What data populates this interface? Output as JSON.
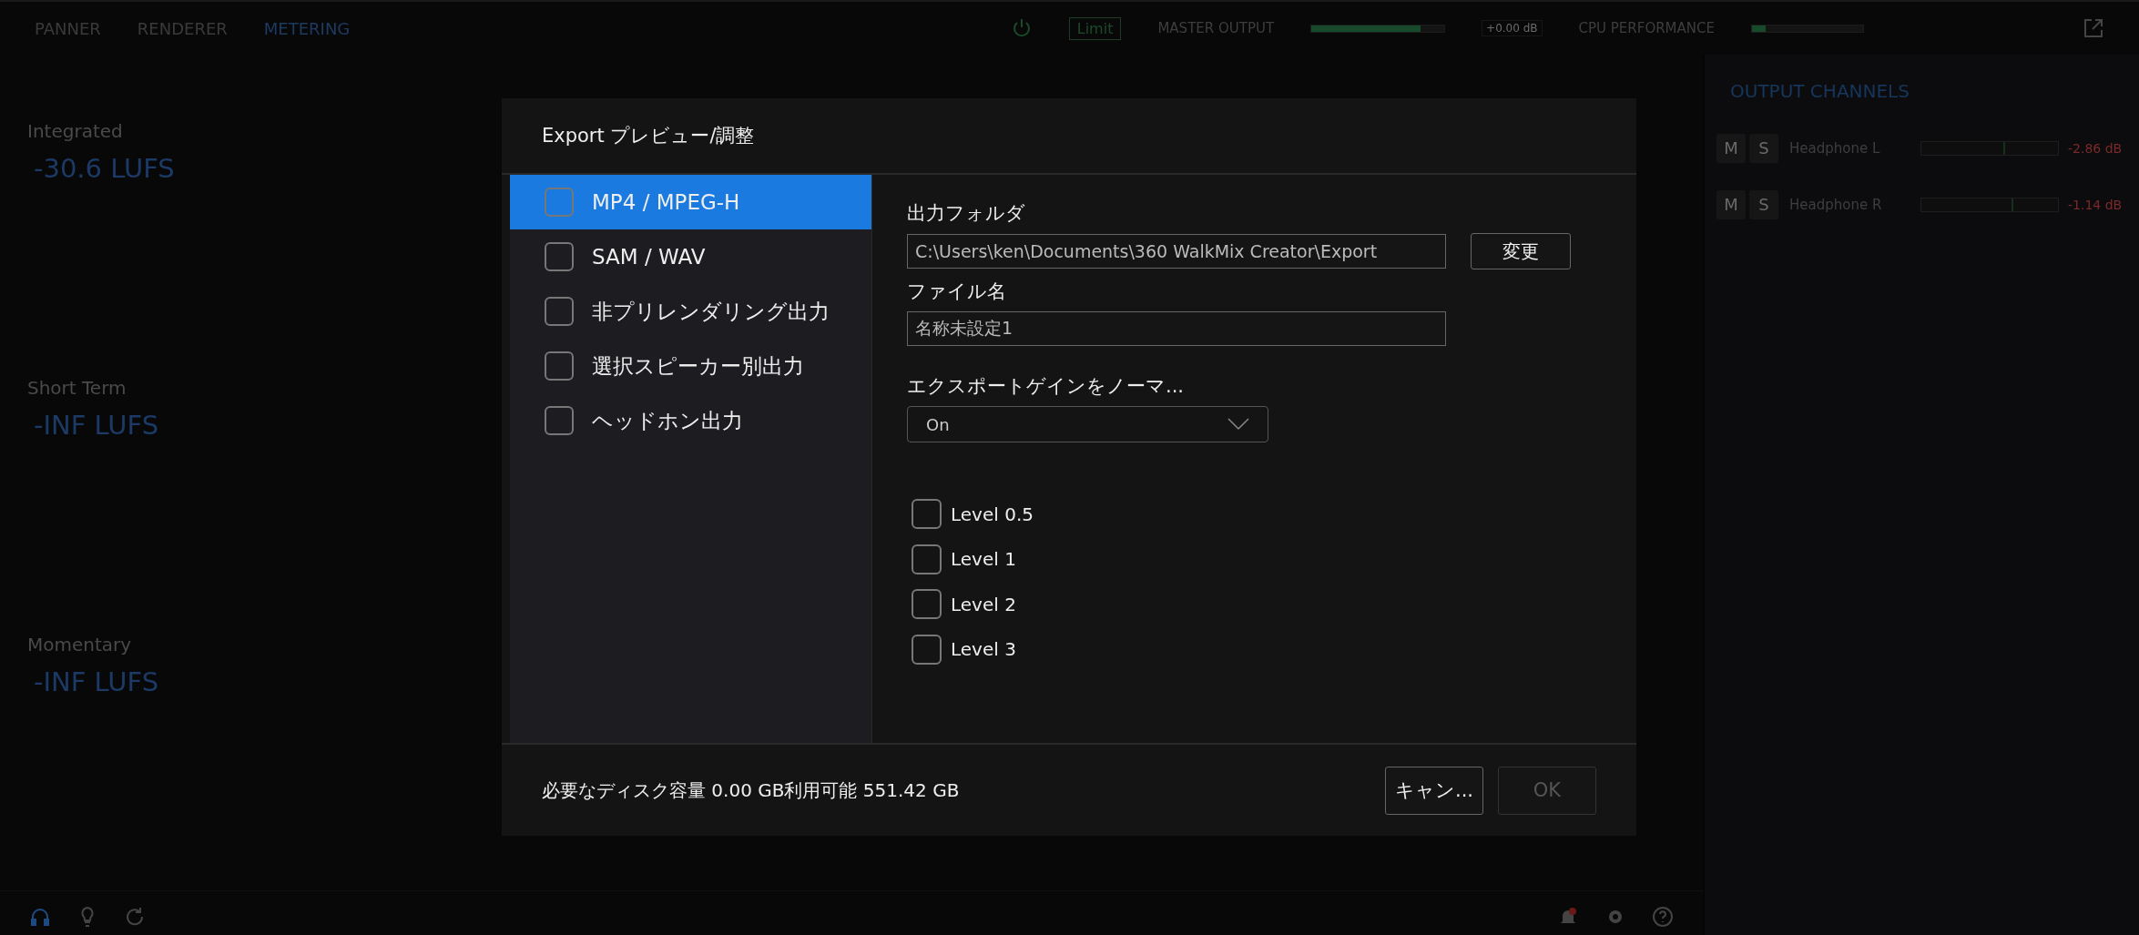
{
  "top_bar": {
    "tabs": [
      {
        "label": "PANNER",
        "selected": false
      },
      {
        "label": "RENDERER",
        "selected": false
      },
      {
        "label": "METERING",
        "selected": true
      }
    ],
    "limit": "Limit",
    "master_output": {
      "label": "MASTER OUTPUT",
      "level": 0.82,
      "reading": "+0.00 dB"
    },
    "cpu": {
      "label": "CPU PERFORMANCE",
      "level": 0.12
    }
  },
  "metering": [
    {
      "label": "Integrated",
      "value": "-30.6 LUFS"
    },
    {
      "label": "Short Term",
      "value": "-INF LUFS"
    },
    {
      "label": "Momentary",
      "value": "-INF LUFS"
    }
  ],
  "output_channels": {
    "title": "OUTPUT CHANNELS",
    "channels": [
      {
        "mute": "M",
        "solo": "S",
        "name": "Headphone L",
        "level": 0.6,
        "reading": "-2.86 dB"
      },
      {
        "mute": "M",
        "solo": "S",
        "name": "Headphone R",
        "level": 0.66,
        "reading": "-1.14 dB"
      }
    ]
  },
  "dialog": {
    "title": "Export プレビュー/調整",
    "formats": [
      {
        "label": "MP4 / MPEG-H",
        "selected": true,
        "checked": false
      },
      {
        "label": "SAM / WAV",
        "selected": false,
        "checked": false
      },
      {
        "label": "非プリレンダリング出力",
        "selected": false,
        "checked": false
      },
      {
        "label": "選択スピーカー別出力",
        "selected": false,
        "checked": false
      },
      {
        "label": "ヘッドホン出力",
        "selected": false,
        "checked": false
      }
    ],
    "output_folder": {
      "label": "出力フォルダ",
      "value": "C:\\Users\\ken\\Documents\\360 WalkMix Creator\\Export",
      "button": "変更"
    },
    "file_name": {
      "label": "ファイル名",
      "value": "名称未設定1"
    },
    "normalize": {
      "label": "エクスポートゲインをノーマ...",
      "value": "On"
    },
    "levels": [
      {
        "label": "Level 0.5",
        "checked": false
      },
      {
        "label": "Level 1",
        "checked": false
      },
      {
        "label": "Level 2",
        "checked": false
      },
      {
        "label": "Level 3",
        "checked": false
      }
    ],
    "disk_info": "必要なディスク容量 0.00 GB利用可能 551.42 GB",
    "buttons": [
      {
        "label": "キャン...",
        "disabled": false
      },
      {
        "label": "OK",
        "disabled": true
      }
    ]
  }
}
